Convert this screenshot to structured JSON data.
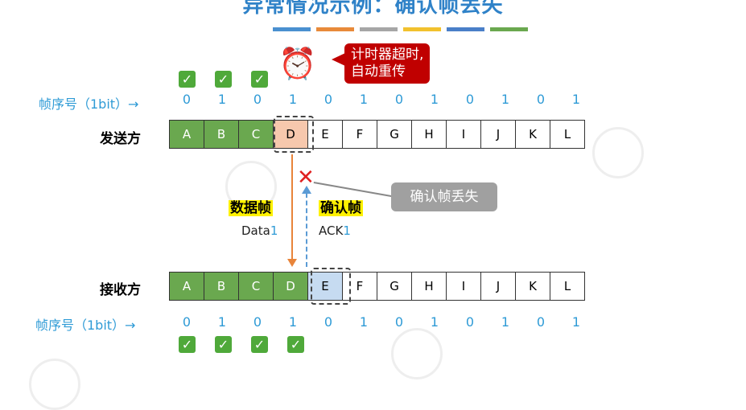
{
  "title": "异常情况示例：确认帧丢失",
  "color_bar": [
    "#4a90d0",
    "#e88a3a",
    "#a6a6a6",
    "#f2c12e",
    "#4a7fc8",
    "#6aa84f"
  ],
  "seq_label": "帧序号（1bit）→",
  "sender": {
    "label": "发送方",
    "frames": [
      "A",
      "B",
      "C",
      "D",
      "E",
      "F",
      "G",
      "H",
      "I",
      "J",
      "K",
      "L"
    ],
    "seq": [
      "0",
      "1",
      "0",
      "1",
      "0",
      "1",
      "0",
      "1",
      "0",
      "1",
      "0",
      "1"
    ],
    "acked_count": 3,
    "current_index": 3
  },
  "receiver": {
    "label": "接收方",
    "frames": [
      "A",
      "B",
      "C",
      "D",
      "E",
      "F",
      "G",
      "H",
      "I",
      "J",
      "K",
      "L"
    ],
    "seq": [
      "0",
      "1",
      "0",
      "1",
      "0",
      "1",
      "0",
      "1",
      "0",
      "1",
      "0",
      "1"
    ],
    "received_count": 4,
    "expected_index": 4
  },
  "timer_callout": {
    "line1": "计时器超时,",
    "line2": "自动重传",
    "color": "#c00000"
  },
  "lost_callout": {
    "text": "确认帧丢失",
    "color": "#a0a0a0"
  },
  "data_frame": {
    "label": "数据帧",
    "name": "Data",
    "num": "1"
  },
  "ack_frame": {
    "label": "确认帧",
    "name": "ACK",
    "num": "1"
  },
  "check_mark": "✓",
  "lost_mark": "✕",
  "alarm_glyph": "⏰"
}
